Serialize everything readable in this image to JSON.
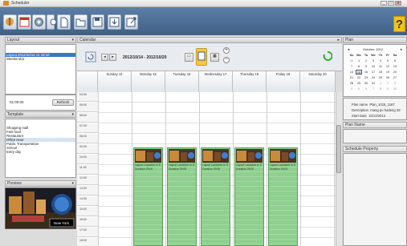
{
  "window": {
    "title": "Scheduler",
    "controls": [
      "_",
      "□",
      "x"
    ]
  },
  "toolbar": {
    "help_label": "?"
  },
  "layout_panel": {
    "header": "Layout",
    "items": [
      "Layout 2012/10/14 14 19:10",
      "Weekend11"
    ],
    "time_value": "01:00:00",
    "refresh_label": "Refresh"
  },
  "template_panel": {
    "header": "Template",
    "items": [
      "Shopping mall",
      "Fast food",
      "Restaurant",
      "Office Hour",
      "Public Transportation",
      "School",
      "Entry day"
    ]
  },
  "preview_panel": {
    "header": "Preview",
    "caption": "New York"
  },
  "calendar": {
    "header": "Calendar",
    "date_range": "2012/10/14 - 2012/10/20",
    "days": [
      "Sunday 14",
      "Monday 15",
      "Tuesday 16",
      "Wednesday 17",
      "Thursday 18",
      "Friday 19",
      "Saturday 20"
    ],
    "times": [
      "04:00",
      "05:00",
      "06:00",
      "07:00",
      "08:00",
      "09:00",
      "10:00",
      "11:00",
      "12:00",
      "13:00",
      "14:00",
      "15:00",
      "16:00",
      "17:00",
      "18:00"
    ],
    "event_line1": "Layout Launcher in S",
    "event_line2": "Duration 09:00",
    "event_days": [
      1,
      2,
      3,
      4,
      5
    ]
  },
  "plan_panel": {
    "header": "Plan",
    "month_label": "October, 2012",
    "weekdays": [
      "Su",
      "Mo",
      "Tu",
      "We",
      "Th",
      "Fr",
      "Sa"
    ],
    "weeks": [
      [
        "30",
        "1",
        "2",
        "3",
        "4",
        "5",
        "6"
      ],
      [
        "7",
        "8",
        "9",
        "10",
        "11",
        "12",
        "13"
      ],
      [
        "14",
        "15",
        "16",
        "17",
        "18",
        "19",
        "20"
      ],
      [
        "21",
        "22",
        "23",
        "24",
        "25",
        "26",
        "27"
      ],
      [
        "28",
        "29",
        "30",
        "31",
        "1",
        "2",
        "3"
      ],
      [
        "4",
        "5",
        "6",
        "7",
        "8",
        "9",
        "10"
      ]
    ],
    "plan_name_label": "Plan name",
    "plan_name_value": "Plan_1015_1187",
    "description_label": "Description",
    "description_value": "mang pu hadeng 28",
    "start_date_label": "Start Date",
    "start_date_value": "10/14/2012",
    "plan_name_section": "Plan Name",
    "schedule_property_section": "Schedule Property"
  },
  "colors": {
    "toolbar": "#4a6b93",
    "event": "#8fcf8f",
    "selection": "#3f76c4",
    "help": "#f0c419"
  }
}
